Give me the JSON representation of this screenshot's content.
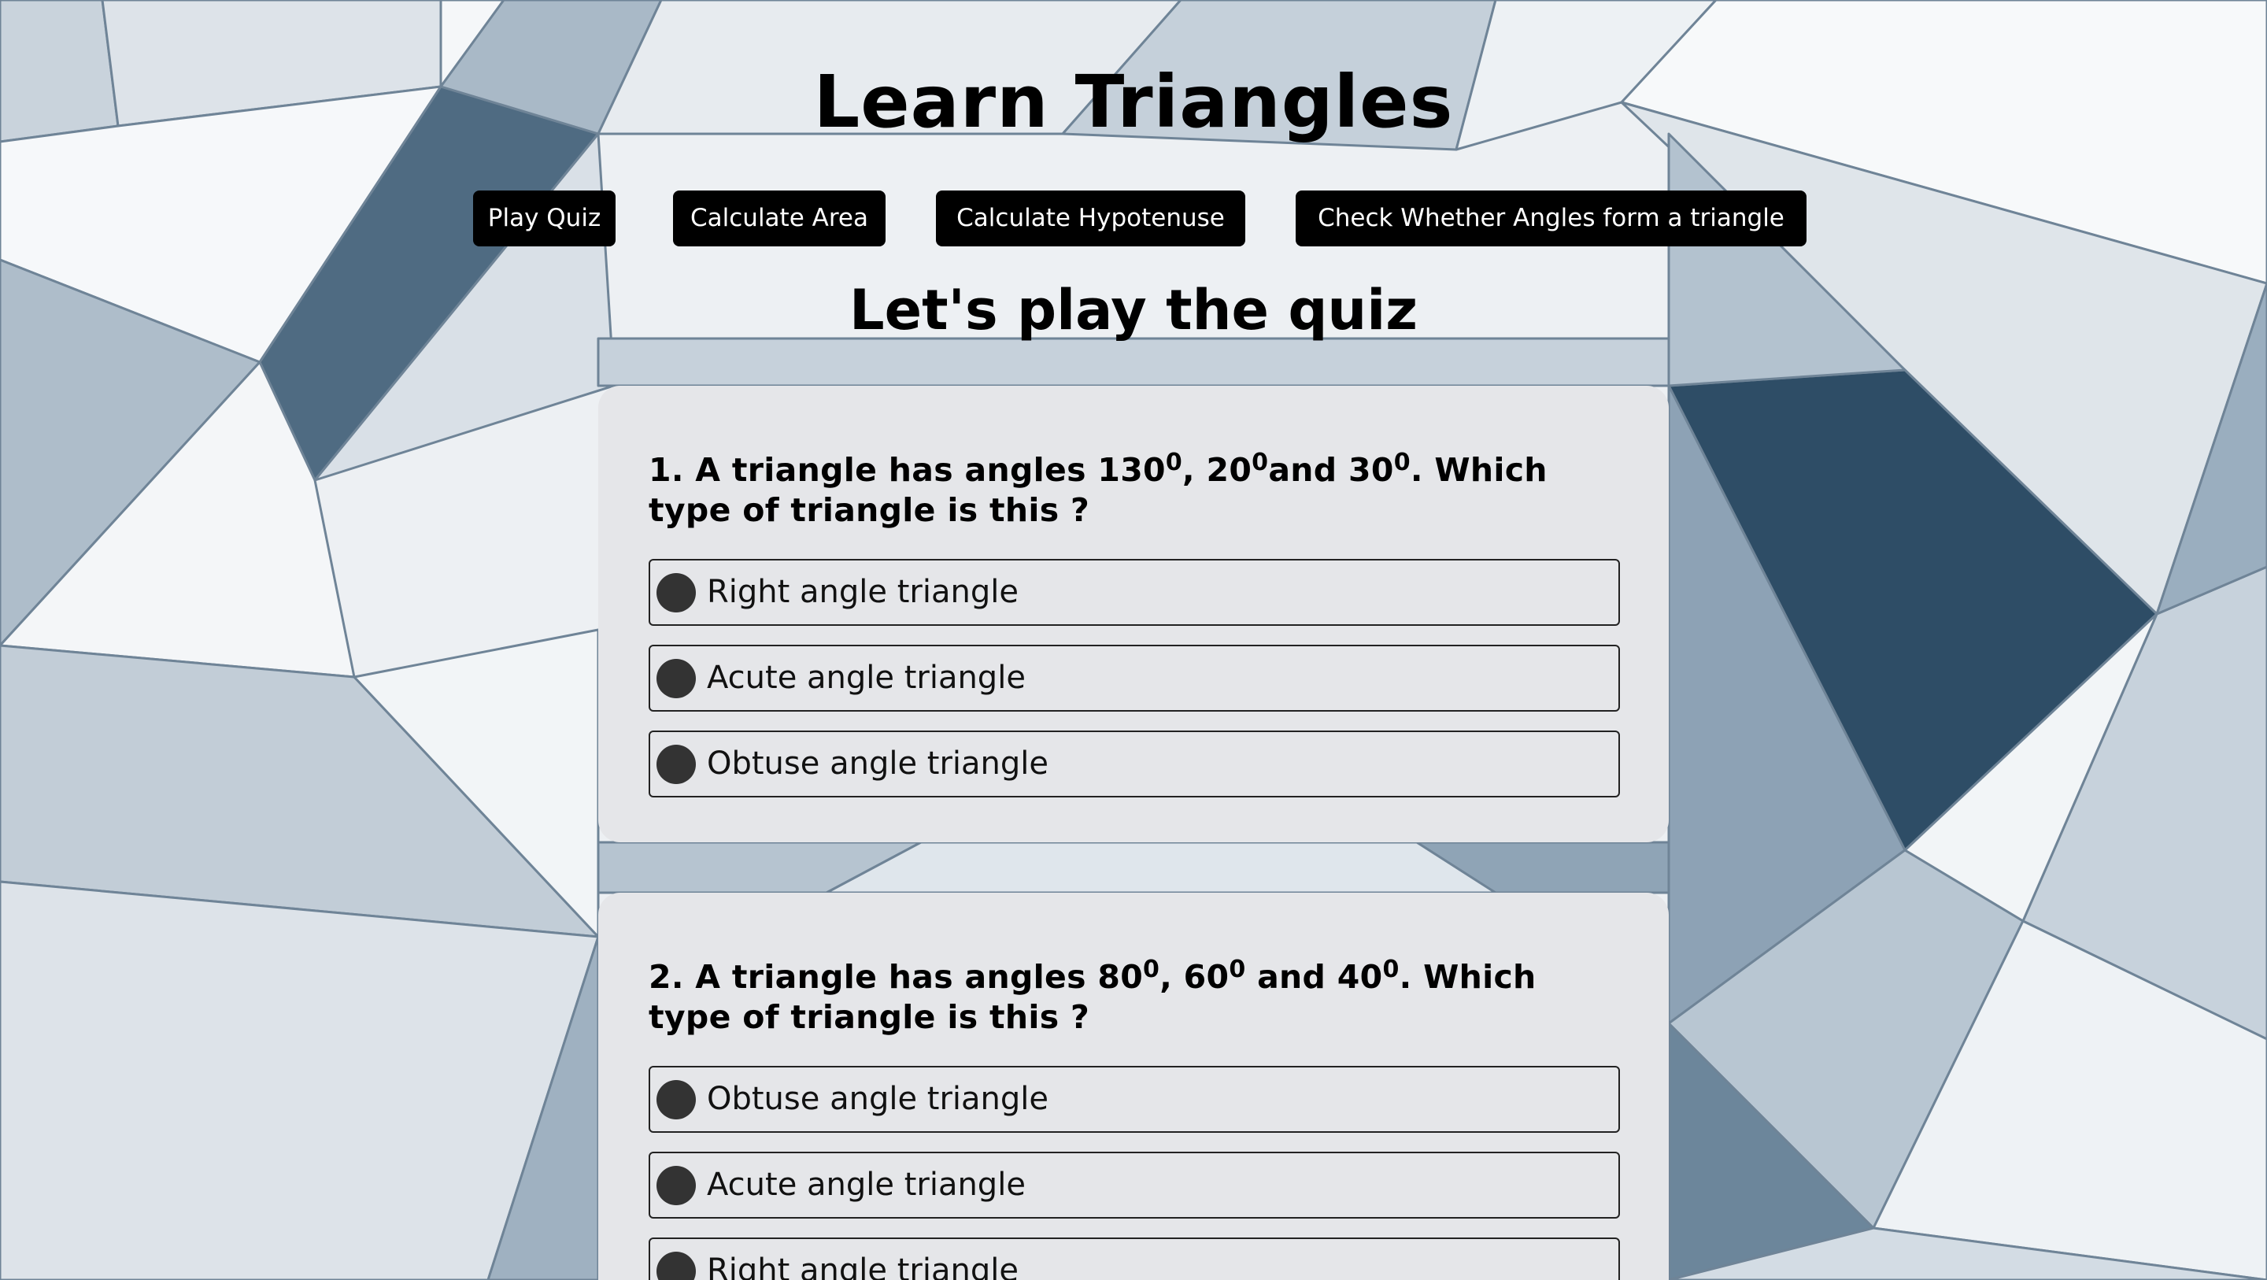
{
  "header": {
    "title": "Learn Triangles"
  },
  "nav": [
    {
      "label": "Play Quiz"
    },
    {
      "label": "Calculate Area"
    },
    {
      "label": "Calculate Hypotenuse"
    },
    {
      "label": "Check Whether Angles form a triangle"
    }
  ],
  "quiz": {
    "heading": "Let's play the quiz",
    "questions": [
      {
        "number": "1.",
        "text_a": " A triangle has angles 130",
        "text_b": ", 20",
        "text_c": "and 30",
        "text_d": ". Which type of triangle is this ?",
        "sup": "0",
        "options": [
          "Right angle triangle",
          "Acute angle triangle",
          "Obtuse angle triangle"
        ]
      },
      {
        "number": "2.",
        "text_a": " A triangle has angles 80",
        "text_b": ", 60",
        "text_c": " and 40",
        "text_d": ". Which type of triangle is this ?",
        "sup": "0",
        "options": [
          "Obtuse angle triangle",
          "Acute angle triangle",
          "Right angle triangle"
        ]
      }
    ]
  },
  "icons": {
    "option_marker": "radio-icon"
  },
  "colors": {
    "nav_button_bg": "#000000",
    "card_bg": "#e5e6e9",
    "radio_fill": "#333333"
  }
}
